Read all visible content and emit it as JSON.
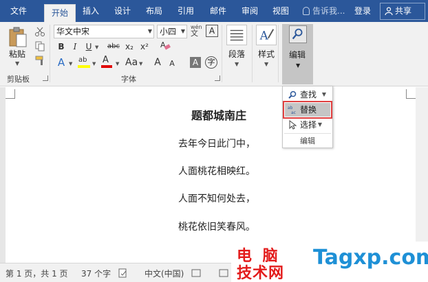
{
  "tabs": [
    "文件",
    "开始",
    "插入",
    "设计",
    "布局",
    "引用",
    "邮件",
    "审阅",
    "视图"
  ],
  "active_tab": "开始",
  "tell_me": "告诉我...",
  "login": "登录",
  "share": "共享",
  "clipboard": {
    "paste": "粘贴",
    "label": "剪贴板"
  },
  "font": {
    "name": "华文中宋",
    "size": "小四",
    "wen_glyph": "wén",
    "label": "字体",
    "buttons": {
      "bold": "B",
      "italic": "I",
      "underline": "U",
      "strike": "abc",
      "sub": "x₂",
      "sup": "x²",
      "grow": "A",
      "shrink": "A"
    }
  },
  "paragraph": {
    "label": "段落"
  },
  "styles": {
    "label": "样式"
  },
  "editing": {
    "label": "编辑"
  },
  "menu": {
    "find": "查找",
    "replace": "替换",
    "select": "选择",
    "footer": "编辑"
  },
  "document": {
    "title": "题都城南庄",
    "lines": [
      "去年今日此门中，",
      "人面桃花相映红。",
      "人面不知何处去，",
      "桃花依旧笑春风。"
    ]
  },
  "status": {
    "page": "第 1 页，共 1 页",
    "words": "37 个字",
    "lang": "中文(中国)"
  },
  "watermark": {
    "cn1": "电 脑",
    "cn2": "技术网",
    "en": "Tagxp.com"
  },
  "colors": {
    "accent": "#2b579a",
    "highlight": "#ffff00",
    "font_color": "#e00000",
    "menu_outline": "#e04040"
  }
}
